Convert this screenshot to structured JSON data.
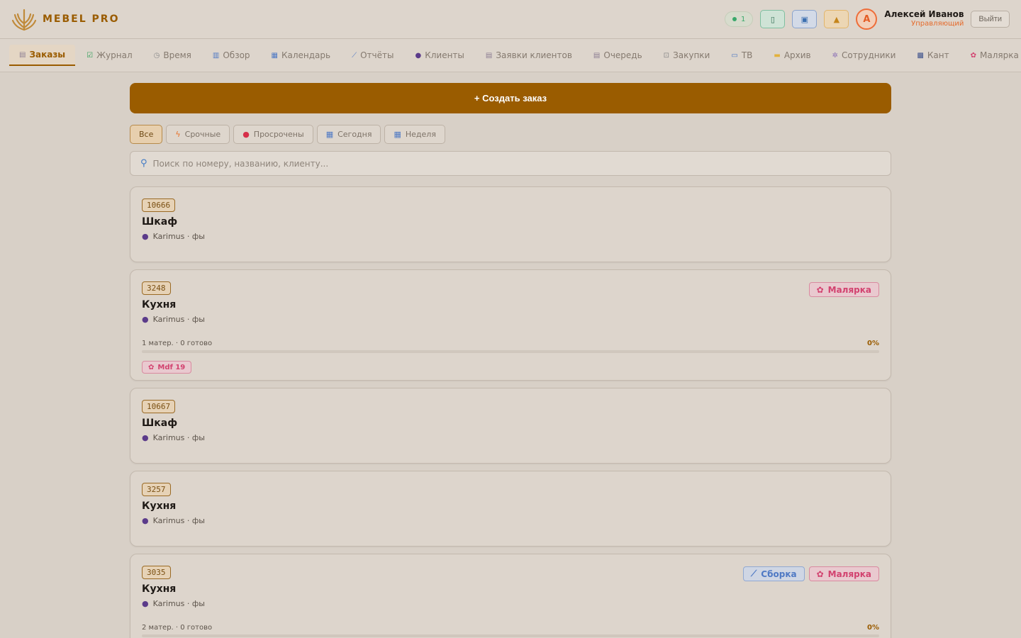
{
  "brand": {
    "name": "MEBEL PRO"
  },
  "header": {
    "online_count": "1",
    "user_initial": "А",
    "user_name": "Алексей Иванов",
    "user_role": "Управляющий",
    "logout_label": "Выйти"
  },
  "nav": {
    "tabs": [
      {
        "label": "Заказы",
        "icon": "clipboard-icon",
        "active": true
      },
      {
        "label": "Журнал",
        "icon": "checkbox-icon"
      },
      {
        "label": "Время",
        "icon": "stopwatch-icon"
      },
      {
        "label": "Обзор",
        "icon": "bar-chart-icon"
      },
      {
        "label": "Календарь",
        "icon": "calendar-icon"
      },
      {
        "label": "Отчёты",
        "icon": "line-chart-icon"
      },
      {
        "label": "Клиенты",
        "icon": "people-icon"
      },
      {
        "label": "Заявки клиентов",
        "icon": "clipboard-icon"
      },
      {
        "label": "Очередь",
        "icon": "clipboard-icon"
      },
      {
        "label": "Закупки",
        "icon": "cart-icon"
      },
      {
        "label": "ТВ",
        "icon": "tv-icon"
      },
      {
        "label": "Архив",
        "icon": "folder-icon"
      },
      {
        "label": "Сотрудники",
        "icon": "gear-icon"
      },
      {
        "label": "Кант",
        "icon": "film-icon"
      },
      {
        "label": "Малярка",
        "icon": "paint-icon"
      }
    ]
  },
  "main": {
    "create_label": "+ Создать заказ",
    "filters": [
      {
        "label": "Все",
        "icon": "",
        "active": true
      },
      {
        "label": "Срочные",
        "icon": "lightning-icon"
      },
      {
        "label": "Просрочены",
        "icon": "red-dot-icon"
      },
      {
        "label": "Сегодня",
        "icon": "calendar-icon"
      },
      {
        "label": "Неделя",
        "icon": "calendar-icon"
      }
    ],
    "search_placeholder": "Поиск по номеру, названию, клиенту..."
  },
  "orders": [
    {
      "number": "10666",
      "title": "Шкаф",
      "client": "Karimus · фы"
    },
    {
      "number": "3248",
      "title": "Кухня",
      "client": "Karimus · фы",
      "tags": [
        "Малярка"
      ],
      "progress_text": "1 матер. · 0 готово",
      "progress_pct": "0%",
      "progress": 0,
      "material": "Mdf 19"
    },
    {
      "number": "10667",
      "title": "Шкаф",
      "client": "Karimus · фы"
    },
    {
      "number": "3257",
      "title": "Кухня",
      "client": "Karimus · фы"
    },
    {
      "number": "3035",
      "title": "Кухня",
      "client": "Karimus · фы",
      "tags": [
        "Сборка",
        "Малярка"
      ],
      "progress_text": "2 матер. · 0 готово",
      "progress_pct": "0%",
      "progress": 0
    }
  ],
  "colors": {
    "accent": "#9a5c00",
    "background": "#d8d0c7",
    "paint_tag": "#d2426f",
    "assembly_tag": "#4f79c4"
  }
}
